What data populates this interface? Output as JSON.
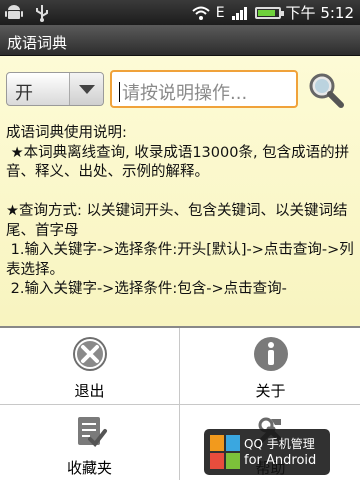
{
  "status_bar": {
    "left_icons": [
      "android-icon",
      "usb-icon"
    ],
    "right_icons": [
      "wifi-icon",
      "edge-icon",
      "signal-icon",
      "battery-icon"
    ],
    "edge_label": "E",
    "battery_level": 0.85,
    "time": "下午 5:12"
  },
  "app": {
    "title": "成语词典"
  },
  "search": {
    "mode_value": "开",
    "placeholder": "请按说明操作...",
    "button_icon": "search-icon"
  },
  "instructions": {
    "lines": [
      "成语词典使用说明:",
      " ★本词典离线查询, 收录成语13000条, 包含成语的拼音、释义、出处、示例的解释。",
      "",
      "★查询方式: 以关键词开头、包含关键词、以关键词结尾、首字母",
      " 1.输入关键字->选择条件:开头[默认]->点击查询->列表选择。",
      " 2.输入关键字->选择条件:包含->点击查询-"
    ]
  },
  "menu": {
    "items": [
      {
        "label": "退出",
        "icon": "close-circle-icon"
      },
      {
        "label": "关于",
        "icon": "info-icon"
      },
      {
        "label": "收藏夹",
        "icon": "checklist-icon"
      },
      {
        "label": "帮助",
        "icon": "tools-icon"
      }
    ]
  },
  "toast": {
    "line1": "QQ 手机管理",
    "line2": "for Android",
    "icon": "qq-manager-icon"
  },
  "colors": {
    "content_bg": "#fdfbd6",
    "input_border": "#f0a23a",
    "titlebar_bg": "#3a3a3a"
  }
}
